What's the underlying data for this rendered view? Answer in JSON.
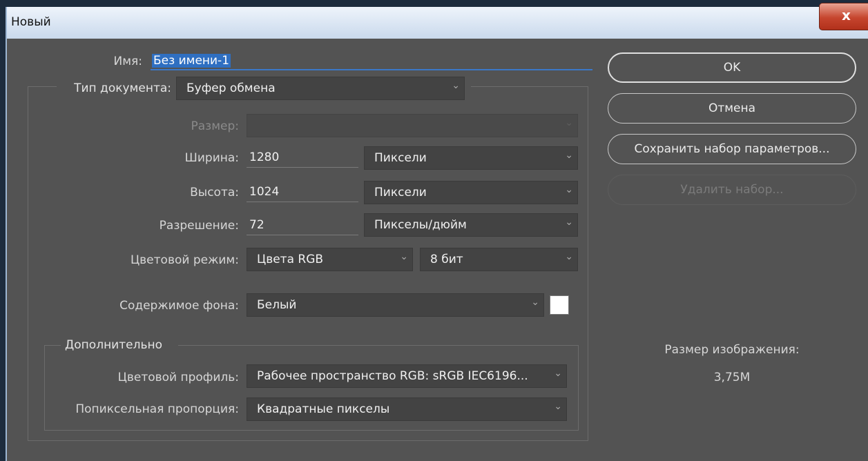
{
  "window": {
    "title": "Новый",
    "close_label": "x"
  },
  "name": {
    "label": "Имя:",
    "value": "Без имени-1"
  },
  "doc_type": {
    "label": "Тип документа:",
    "value": "Буфер обмена"
  },
  "size": {
    "label": "Размер:",
    "value": ""
  },
  "width": {
    "label": "Ширина:",
    "value": "1280",
    "unit": "Пиксели"
  },
  "height": {
    "label": "Высота:",
    "value": "1024",
    "unit": "Пиксели"
  },
  "resolution": {
    "label": "Разрешение:",
    "value": "72",
    "unit": "Пикселы/дюйм"
  },
  "color_mode": {
    "label": "Цветовой режим:",
    "value": "Цвета RGB",
    "depth": "8 бит"
  },
  "background": {
    "label": "Содержимое фона:",
    "value": "Белый",
    "swatch_color": "#ffffff"
  },
  "advanced": {
    "title": "Дополнительно",
    "color_profile": {
      "label": "Цветовой профиль:",
      "value": "Рабочее пространство RGB:  sRGB IEC6196..."
    },
    "pixel_aspect": {
      "label": "Попиксельная пропорция:",
      "value": "Квадратные пикселы"
    }
  },
  "buttons": {
    "ok": "OK",
    "cancel": "Отмена",
    "save_preset": "Сохранить набор параметров...",
    "delete_preset": "Удалить набор..."
  },
  "image_size": {
    "label": "Размер изображения:",
    "value": "3,75M"
  },
  "colors": {
    "dialog_bg": "#535353",
    "selection": "#2f6fc1",
    "close": "#c6452e"
  }
}
